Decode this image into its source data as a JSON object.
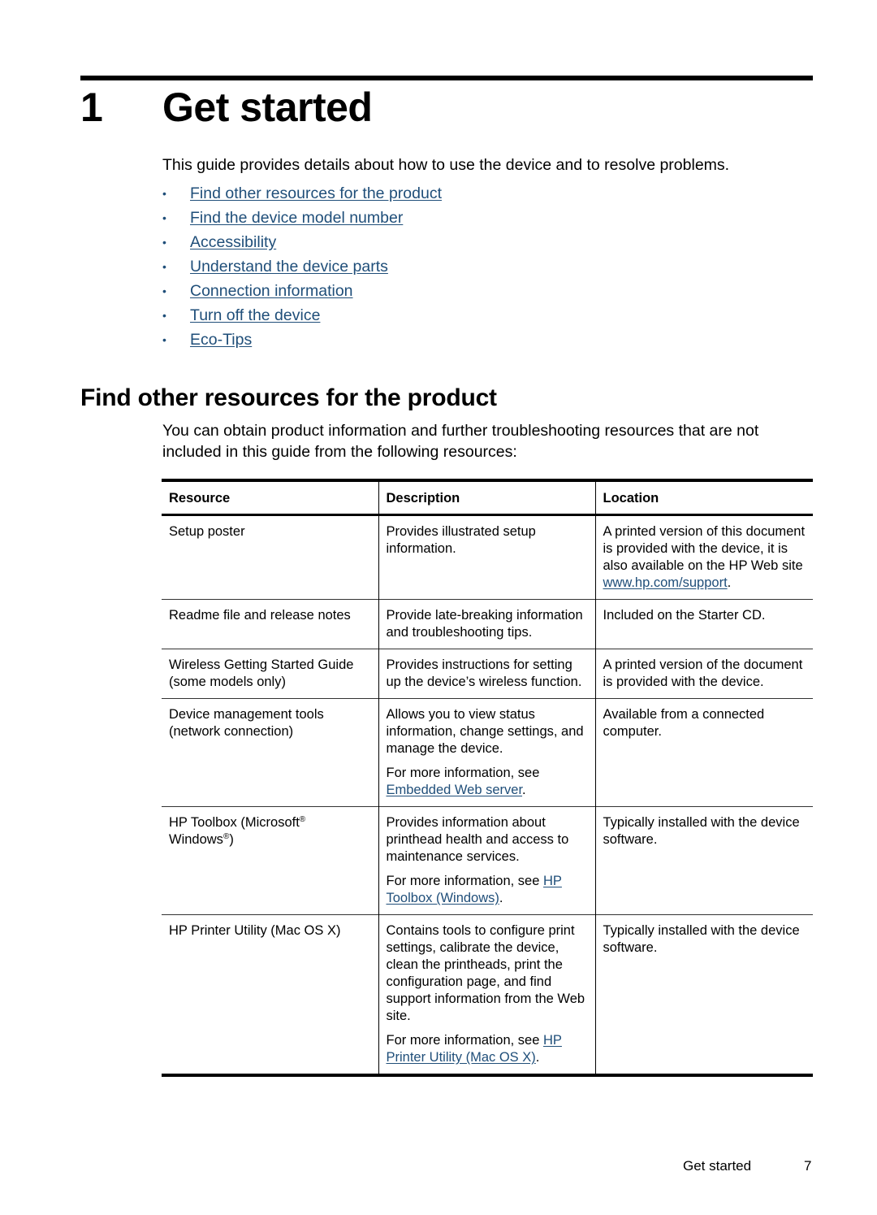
{
  "chapter": {
    "number": "1",
    "title": "Get started"
  },
  "intro": "This guide provides details about how to use the device and to resolve problems.",
  "toc": [
    {
      "label": "Find other resources for the product"
    },
    {
      "label": "Find the device model number"
    },
    {
      "label": "Accessibility"
    },
    {
      "label": "Understand the device parts"
    },
    {
      "label": "Connection information"
    },
    {
      "label": "Turn off the device"
    },
    {
      "label": "Eco-Tips"
    }
  ],
  "bullet_glyph": "•",
  "section": {
    "title": "Find other resources for the product",
    "lead": "You can obtain product information and further troubleshooting resources that are not included in this guide from the following resources:"
  },
  "table": {
    "headers": {
      "resource": "Resource",
      "description": "Description",
      "location": "Location"
    },
    "rows": [
      {
        "resource": "Setup poster",
        "description": "Provides illustrated setup information.",
        "location_text": "A printed version of this document is provided with the device, it is also available on the HP Web site ",
        "location_link": "www.hp.com/support",
        "location_after": "."
      },
      {
        "resource": "Readme file and release notes",
        "description": "Provide late-breaking information and troubleshooting tips.",
        "location": "Included on the Starter CD."
      },
      {
        "resource": "Wireless Getting Started Guide (some models only)",
        "description": "Provides instructions for setting up the device’s wireless function.",
        "location": "A printed version of the document is provided with the device."
      },
      {
        "resource": "Device management tools (network connection)",
        "description": "Allows you to view status information, change settings, and manage the device.",
        "more_prefix": "For more information, see ",
        "more_link": "Embedded Web server",
        "more_after": ".",
        "location": "Available from a connected computer."
      },
      {
        "resource_a": "HP Toolbox (Microsoft",
        "resource_sup1": "®",
        "resource_b": " Windows",
        "resource_sup2": "®",
        "resource_c": ")",
        "description": "Provides information about printhead health and access to maintenance services.",
        "more_prefix": "For more information, see ",
        "more_link": "HP Toolbox (Windows)",
        "more_after": ".",
        "location": "Typically installed with the device software."
      },
      {
        "resource": "HP Printer Utility (Mac OS X)",
        "description": "Contains tools to configure print settings, calibrate the device, clean the printheads, print the configuration page, and find support information from the Web site.",
        "more_prefix": "For more information, see ",
        "more_link": "HP Printer Utility (Mac OS X)",
        "more_after": ".",
        "location": "Typically installed with the device software."
      }
    ]
  },
  "footer": {
    "label": "Get started",
    "page": "7"
  },
  "colors": {
    "link": "#1f4e79",
    "text": "#000000"
  }
}
